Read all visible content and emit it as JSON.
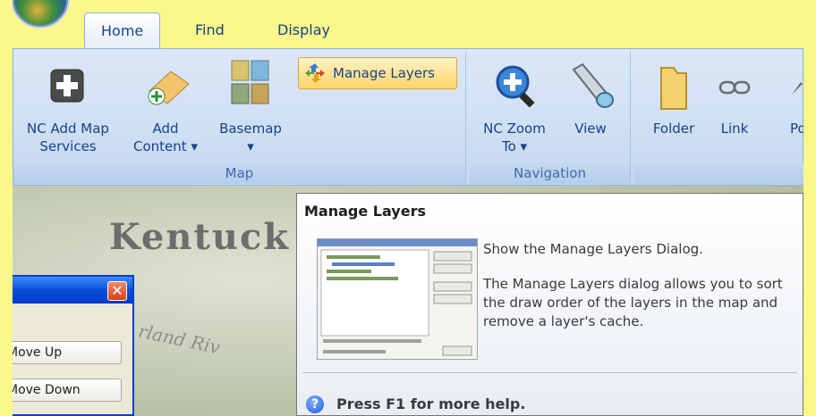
{
  "tabs": [
    {
      "label": "Home",
      "active": true
    },
    {
      "label": "Find",
      "active": false
    },
    {
      "label": "Display",
      "active": false
    }
  ],
  "ribbon": {
    "groups": [
      {
        "name": "Map",
        "buttons": [
          {
            "line1": "NC Add Map",
            "line2": "Services",
            "icon": "add-map-services-icon"
          },
          {
            "line1": "Add",
            "line2": "Content ▾",
            "icon": "add-content-icon"
          },
          {
            "line1": "Basemap",
            "line2": "▾",
            "icon": "basemap-icon"
          }
        ],
        "manage_layers": "Manage Layers"
      },
      {
        "name": "Navigation",
        "buttons": [
          {
            "line1": "NC Zoom",
            "line2": "To ▾",
            "icon": "zoom-to-icon"
          },
          {
            "line1": "View",
            "line2": "",
            "icon": "view-icon"
          }
        ]
      },
      {
        "name": "",
        "buttons": [
          {
            "line1": "Folder",
            "line2": "",
            "icon": "folder-icon"
          },
          {
            "line1": "Link",
            "line2": "",
            "icon": "link-icon"
          },
          {
            "line1": "Po",
            "line2": "",
            "icon": "point-icon"
          }
        ]
      }
    ]
  },
  "map": {
    "label_state": "Kentuck",
    "label_river": "rland Riv"
  },
  "dialog": {
    "close_glyph": "✕",
    "buttons": [
      "Move Up",
      "Move Down"
    ]
  },
  "tooltip": {
    "title": "Manage Layers",
    "line1": "Show the Manage Layers Dialog.",
    "line2": "The Manage Layers dialog allows you to sort the draw order of the layers in the map and remove a layer's cache.",
    "help": "Press F1 for more help.",
    "help_glyph": "?"
  },
  "colors": {
    "highlight": "#fbf78a",
    "ribbon": "#cfdff3",
    "accent": "#15428b"
  }
}
